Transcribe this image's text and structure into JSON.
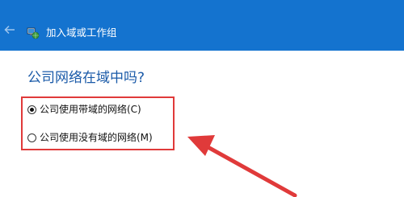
{
  "window": {
    "title": "加入域或工作组",
    "back_icon": "back-arrow-icon",
    "app_icon": "network-computer-icon",
    "header_color": "#1473cf"
  },
  "main": {
    "question": "公司网络在域中吗?",
    "question_color": "#1a5aa8",
    "options": [
      {
        "label": "公司使用带域的网络(C)",
        "selected": true
      },
      {
        "label": "公司使用没有域的网络(M)",
        "selected": false
      }
    ]
  },
  "annotation": {
    "color": "#e03a3a",
    "highlight": "red-rectangle",
    "pointer": "red-arrow"
  }
}
